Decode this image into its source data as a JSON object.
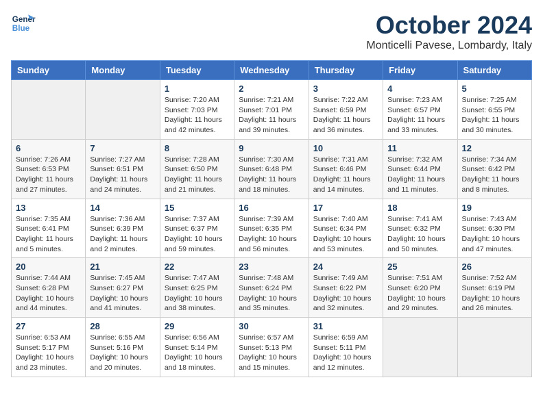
{
  "header": {
    "logo_line1": "General",
    "logo_line2": "Blue",
    "month": "October 2024",
    "location": "Monticelli Pavese, Lombardy, Italy"
  },
  "weekdays": [
    "Sunday",
    "Monday",
    "Tuesday",
    "Wednesday",
    "Thursday",
    "Friday",
    "Saturday"
  ],
  "weeks": [
    [
      {
        "day": "",
        "sunrise": "",
        "sunset": "",
        "daylight": ""
      },
      {
        "day": "",
        "sunrise": "",
        "sunset": "",
        "daylight": ""
      },
      {
        "day": "1",
        "sunrise": "Sunrise: 7:20 AM",
        "sunset": "Sunset: 7:03 PM",
        "daylight": "Daylight: 11 hours and 42 minutes."
      },
      {
        "day": "2",
        "sunrise": "Sunrise: 7:21 AM",
        "sunset": "Sunset: 7:01 PM",
        "daylight": "Daylight: 11 hours and 39 minutes."
      },
      {
        "day": "3",
        "sunrise": "Sunrise: 7:22 AM",
        "sunset": "Sunset: 6:59 PM",
        "daylight": "Daylight: 11 hours and 36 minutes."
      },
      {
        "day": "4",
        "sunrise": "Sunrise: 7:23 AM",
        "sunset": "Sunset: 6:57 PM",
        "daylight": "Daylight: 11 hours and 33 minutes."
      },
      {
        "day": "5",
        "sunrise": "Sunrise: 7:25 AM",
        "sunset": "Sunset: 6:55 PM",
        "daylight": "Daylight: 11 hours and 30 minutes."
      }
    ],
    [
      {
        "day": "6",
        "sunrise": "Sunrise: 7:26 AM",
        "sunset": "Sunset: 6:53 PM",
        "daylight": "Daylight: 11 hours and 27 minutes."
      },
      {
        "day": "7",
        "sunrise": "Sunrise: 7:27 AM",
        "sunset": "Sunset: 6:51 PM",
        "daylight": "Daylight: 11 hours and 24 minutes."
      },
      {
        "day": "8",
        "sunrise": "Sunrise: 7:28 AM",
        "sunset": "Sunset: 6:50 PM",
        "daylight": "Daylight: 11 hours and 21 minutes."
      },
      {
        "day": "9",
        "sunrise": "Sunrise: 7:30 AM",
        "sunset": "Sunset: 6:48 PM",
        "daylight": "Daylight: 11 hours and 18 minutes."
      },
      {
        "day": "10",
        "sunrise": "Sunrise: 7:31 AM",
        "sunset": "Sunset: 6:46 PM",
        "daylight": "Daylight: 11 hours and 14 minutes."
      },
      {
        "day": "11",
        "sunrise": "Sunrise: 7:32 AM",
        "sunset": "Sunset: 6:44 PM",
        "daylight": "Daylight: 11 hours and 11 minutes."
      },
      {
        "day": "12",
        "sunrise": "Sunrise: 7:34 AM",
        "sunset": "Sunset: 6:42 PM",
        "daylight": "Daylight: 11 hours and 8 minutes."
      }
    ],
    [
      {
        "day": "13",
        "sunrise": "Sunrise: 7:35 AM",
        "sunset": "Sunset: 6:41 PM",
        "daylight": "Daylight: 11 hours and 5 minutes."
      },
      {
        "day": "14",
        "sunrise": "Sunrise: 7:36 AM",
        "sunset": "Sunset: 6:39 PM",
        "daylight": "Daylight: 11 hours and 2 minutes."
      },
      {
        "day": "15",
        "sunrise": "Sunrise: 7:37 AM",
        "sunset": "Sunset: 6:37 PM",
        "daylight": "Daylight: 10 hours and 59 minutes."
      },
      {
        "day": "16",
        "sunrise": "Sunrise: 7:39 AM",
        "sunset": "Sunset: 6:35 PM",
        "daylight": "Daylight: 10 hours and 56 minutes."
      },
      {
        "day": "17",
        "sunrise": "Sunrise: 7:40 AM",
        "sunset": "Sunset: 6:34 PM",
        "daylight": "Daylight: 10 hours and 53 minutes."
      },
      {
        "day": "18",
        "sunrise": "Sunrise: 7:41 AM",
        "sunset": "Sunset: 6:32 PM",
        "daylight": "Daylight: 10 hours and 50 minutes."
      },
      {
        "day": "19",
        "sunrise": "Sunrise: 7:43 AM",
        "sunset": "Sunset: 6:30 PM",
        "daylight": "Daylight: 10 hours and 47 minutes."
      }
    ],
    [
      {
        "day": "20",
        "sunrise": "Sunrise: 7:44 AM",
        "sunset": "Sunset: 6:28 PM",
        "daylight": "Daylight: 10 hours and 44 minutes."
      },
      {
        "day": "21",
        "sunrise": "Sunrise: 7:45 AM",
        "sunset": "Sunset: 6:27 PM",
        "daylight": "Daylight: 10 hours and 41 minutes."
      },
      {
        "day": "22",
        "sunrise": "Sunrise: 7:47 AM",
        "sunset": "Sunset: 6:25 PM",
        "daylight": "Daylight: 10 hours and 38 minutes."
      },
      {
        "day": "23",
        "sunrise": "Sunrise: 7:48 AM",
        "sunset": "Sunset: 6:24 PM",
        "daylight": "Daylight: 10 hours and 35 minutes."
      },
      {
        "day": "24",
        "sunrise": "Sunrise: 7:49 AM",
        "sunset": "Sunset: 6:22 PM",
        "daylight": "Daylight: 10 hours and 32 minutes."
      },
      {
        "day": "25",
        "sunrise": "Sunrise: 7:51 AM",
        "sunset": "Sunset: 6:20 PM",
        "daylight": "Daylight: 10 hours and 29 minutes."
      },
      {
        "day": "26",
        "sunrise": "Sunrise: 7:52 AM",
        "sunset": "Sunset: 6:19 PM",
        "daylight": "Daylight: 10 hours and 26 minutes."
      }
    ],
    [
      {
        "day": "27",
        "sunrise": "Sunrise: 6:53 AM",
        "sunset": "Sunset: 5:17 PM",
        "daylight": "Daylight: 10 hours and 23 minutes."
      },
      {
        "day": "28",
        "sunrise": "Sunrise: 6:55 AM",
        "sunset": "Sunset: 5:16 PM",
        "daylight": "Daylight: 10 hours and 20 minutes."
      },
      {
        "day": "29",
        "sunrise": "Sunrise: 6:56 AM",
        "sunset": "Sunset: 5:14 PM",
        "daylight": "Daylight: 10 hours and 18 minutes."
      },
      {
        "day": "30",
        "sunrise": "Sunrise: 6:57 AM",
        "sunset": "Sunset: 5:13 PM",
        "daylight": "Daylight: 10 hours and 15 minutes."
      },
      {
        "day": "31",
        "sunrise": "Sunrise: 6:59 AM",
        "sunset": "Sunset: 5:11 PM",
        "daylight": "Daylight: 10 hours and 12 minutes."
      },
      {
        "day": "",
        "sunrise": "",
        "sunset": "",
        "daylight": ""
      },
      {
        "day": "",
        "sunrise": "",
        "sunset": "",
        "daylight": ""
      }
    ]
  ]
}
